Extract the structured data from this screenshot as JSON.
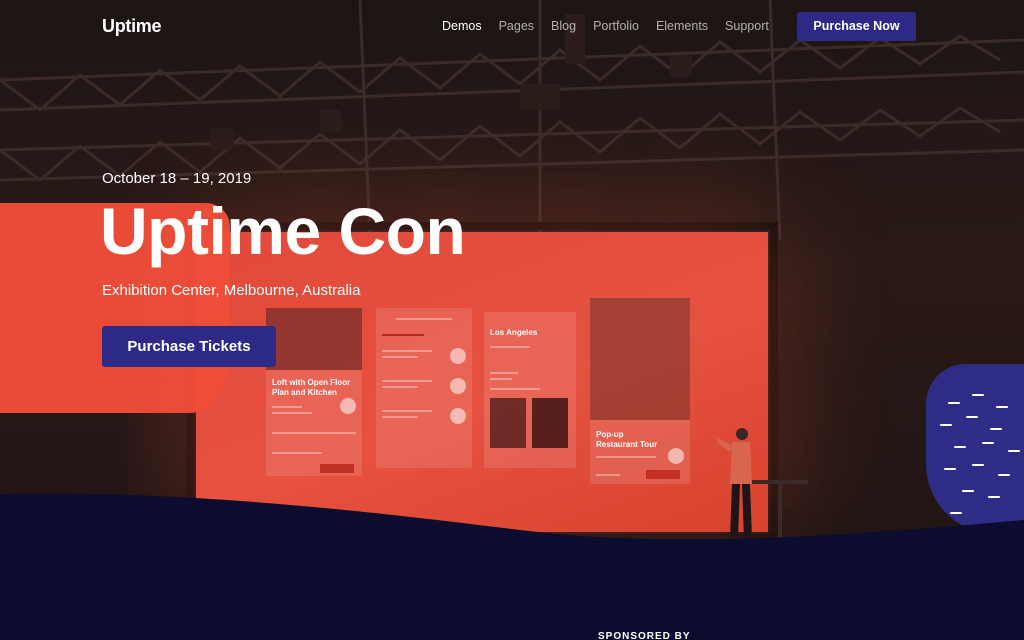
{
  "brand": {
    "logo_text": "Uptime"
  },
  "nav": {
    "items": [
      {
        "label": "Demos",
        "active": true
      },
      {
        "label": "Pages",
        "active": false
      },
      {
        "label": "Blog",
        "active": false
      },
      {
        "label": "Portfolio",
        "active": false
      },
      {
        "label": "Elements",
        "active": false
      },
      {
        "label": "Support",
        "active": false
      }
    ],
    "cta_label": "Purchase Now"
  },
  "hero": {
    "date": "October 18 – 19, 2019",
    "title": "Uptime Con",
    "location": "Exhibition Center, Melbourne, Australia",
    "cta_label": "Purchase Tickets"
  },
  "screen_cards": {
    "card1_title": "Loft with Open Floor Plan and Kitchen",
    "card3_title": "Los Angeles",
    "card4_title": "Pop-up Restaurant Tour"
  },
  "footer_peek": {
    "sponsor_label": "SPONSORED BY"
  },
  "colors": {
    "accent": "#2c2a86",
    "brand_red": "#ef4d39",
    "navy": "#0c0d2e"
  }
}
